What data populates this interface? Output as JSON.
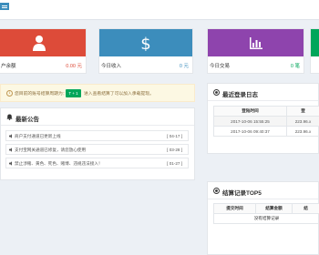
{
  "stats": [
    {
      "label": "户余额",
      "value": "0.00 元",
      "icon": "user-icon"
    },
    {
      "label": "今日收入",
      "value": "0 元",
      "icon": "dollar-icon"
    },
    {
      "label": "今日交易",
      "value": "0 笔",
      "icon": "bar-chart-icon"
    }
  ],
  "notice": {
    "text_before": "您目前的账号结算周期为：",
    "badge": "T + 1",
    "text_after": "进入查看结算了可以加入承载提现。"
  },
  "news": {
    "title": "最新公告",
    "items": [
      {
        "title": "商户支付通道已更新上线",
        "date": "[ 04-17 ]"
      },
      {
        "title": "支付宝网关通道已修复，请您放心使用",
        "date": "[ 03-28 ]"
      },
      {
        "title": "禁止涉赌、黄色、死色、赌博、违规违法接入！",
        "date": "[ 01-27 ]"
      }
    ]
  },
  "login_log": {
    "title": "最近登录日志",
    "columns": [
      "登陆时间",
      "登"
    ],
    "rows": [
      {
        "time": "2017-10-06 15:55:25",
        "ip": "223.96.x"
      },
      {
        "time": "2017-10-06 09:40:37",
        "ip": "223.96.x"
      }
    ]
  },
  "settle_log": {
    "title": "结算记录TOP5",
    "columns": [
      "提交时间",
      "结算金额",
      "结"
    ],
    "empty": "没有结算记录"
  },
  "colors": {
    "red": "#dd4b39",
    "blue": "#3c8dbc",
    "purple": "#8e44ad",
    "green": "#00a65a",
    "background": "#ecf0f5"
  }
}
